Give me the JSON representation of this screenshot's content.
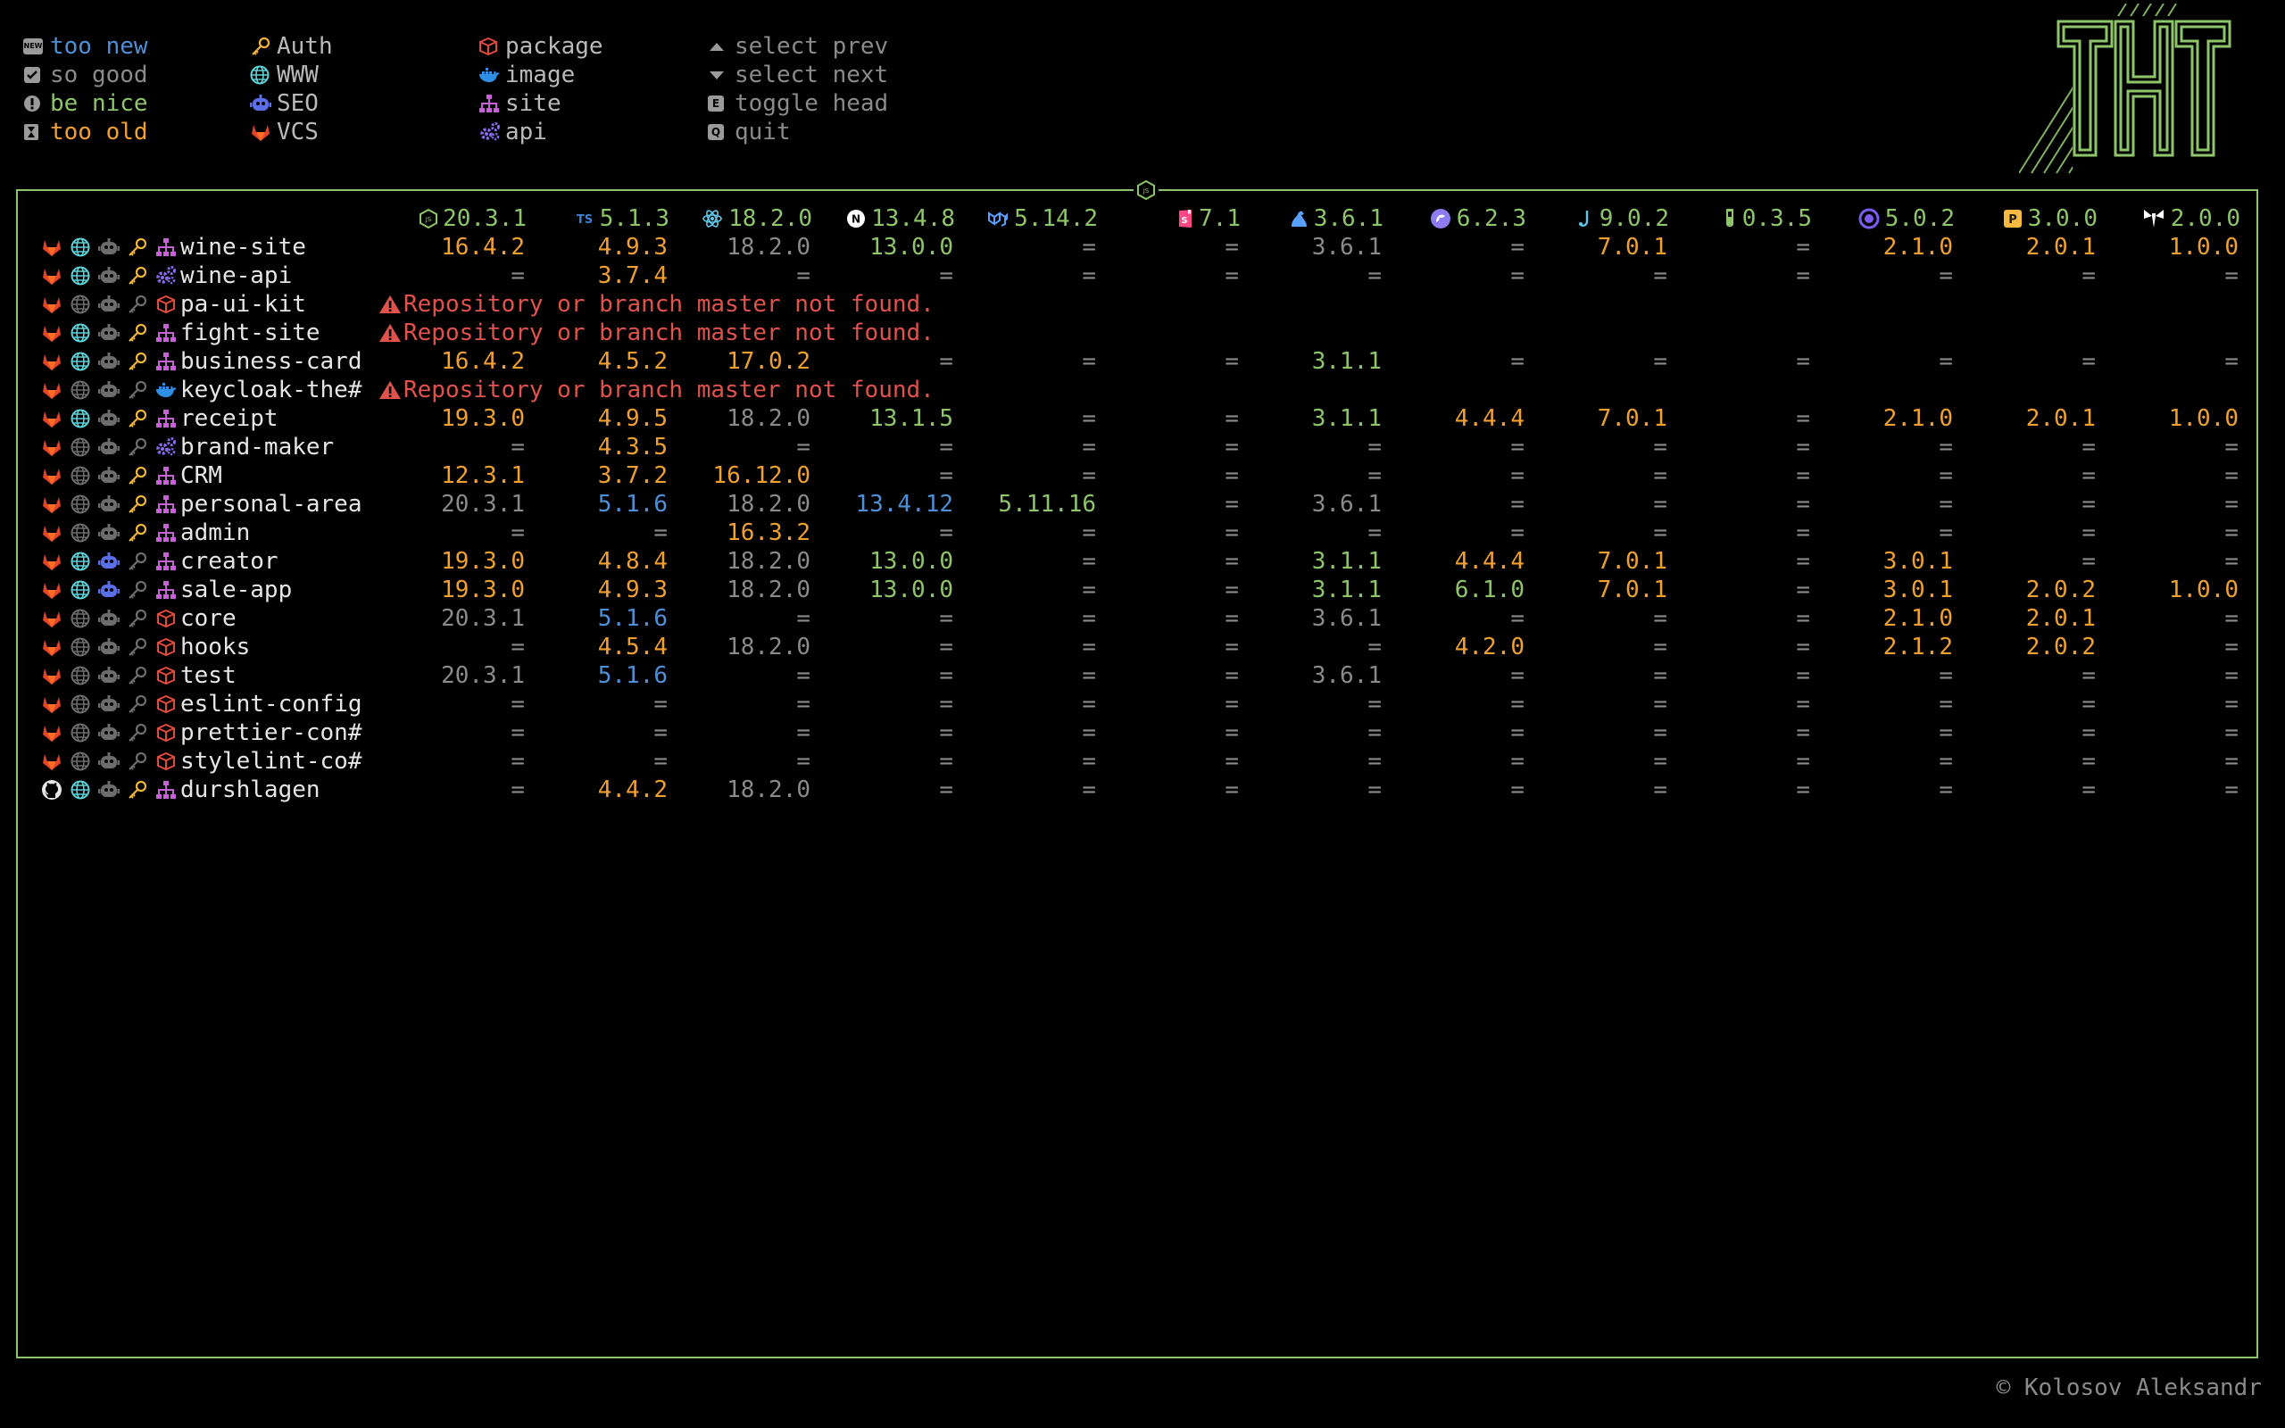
{
  "legend": {
    "status": [
      {
        "icon": "new-badge-icon",
        "label": "too new",
        "color": "#4f8fd6"
      },
      {
        "icon": "checkbox-icon",
        "label": "so good",
        "color": "#8a8a8a"
      },
      {
        "icon": "exclamation-icon",
        "label": "be nice",
        "color": "#8ec46a"
      },
      {
        "icon": "hourglass-icon",
        "label": "too old",
        "color": "#f0a030"
      }
    ],
    "tags": [
      {
        "icon": "key-icon",
        "label": "Auth"
      },
      {
        "icon": "globe-icon",
        "label": "WWW"
      },
      {
        "icon": "robot-icon",
        "label": "SEO"
      },
      {
        "icon": "gitlab-icon",
        "label": "VCS"
      }
    ],
    "types": [
      {
        "icon": "package-icon",
        "label": "package"
      },
      {
        "icon": "docker-icon",
        "label": "image"
      },
      {
        "icon": "sitemap-icon",
        "label": "site"
      },
      {
        "icon": "gears-icon",
        "label": "api"
      }
    ],
    "keys": [
      {
        "icon": "arrow-up-icon",
        "label": "select prev"
      },
      {
        "icon": "arrow-down-icon",
        "label": "select next"
      },
      {
        "icon": "key-e-icon",
        "label": "toggle head",
        "key": "E"
      },
      {
        "icon": "key-q-icon",
        "label": "quit",
        "key": "Q"
      }
    ]
  },
  "frame_badge_icon": "nodejs-icon",
  "columns": [
    {
      "icon": "nodejs-icon",
      "version": "20.3.1",
      "color": "#8ec46a"
    },
    {
      "icon": "typescript-icon",
      "version": "5.1.3",
      "color": "#3f7fd0"
    },
    {
      "icon": "react-icon",
      "version": "18.2.0",
      "color": "#5fc8e8"
    },
    {
      "icon": "nextjs-icon",
      "version": "13.4.8",
      "color": "#ffffff"
    },
    {
      "icon": "mui-icon",
      "version": "5.14.2",
      "color": "#5aa0ff"
    },
    {
      "icon": "storybook-icon",
      "version": "7.1",
      "color": "#ff4785"
    },
    {
      "icon": "redux-saga-icon",
      "version": "3.6.1",
      "color": "#5aa0ff"
    },
    {
      "icon": "styled-components-icon",
      "version": "6.2.3",
      "color": "#8c7cf0"
    },
    {
      "icon": "jest-icon",
      "version": "9.0.2",
      "color": "#5fc8e8"
    },
    {
      "icon": "vitest-icon",
      "version": "0.3.5",
      "color": "#8ec46a"
    },
    {
      "icon": "vite-icon",
      "version": "5.0.2",
      "color": "#7a5cf0"
    },
    {
      "icon": "prettier-icon",
      "version": "3.0.0",
      "color": "#f7b93e"
    },
    {
      "icon": "tuxedo-icon",
      "version": "2.0.0",
      "color": "#ffffff"
    }
  ],
  "projects": [
    {
      "name": "wine-site",
      "vcs": "gitlab",
      "www": true,
      "seo": false,
      "auth": true,
      "type": "site",
      "values": [
        [
          "16.4.2",
          "orange"
        ],
        [
          "4.9.3",
          "orange"
        ],
        [
          "18.2.0",
          "grey"
        ],
        [
          "13.0.0",
          "green"
        ],
        [
          "=",
          "dash"
        ],
        [
          "=",
          "dash"
        ],
        [
          "3.6.1",
          "grey"
        ],
        [
          "=",
          "dash"
        ],
        [
          "7.0.1",
          "orange"
        ],
        [
          "=",
          "dash"
        ],
        [
          "2.1.0",
          "orange"
        ],
        [
          "2.0.1",
          "orange"
        ],
        [
          "1.0.0",
          "orange"
        ]
      ]
    },
    {
      "name": "wine-api",
      "vcs": "gitlab",
      "www": true,
      "seo": false,
      "auth": true,
      "type": "api",
      "values": [
        [
          "=",
          "dash"
        ],
        [
          "3.7.4",
          "orange"
        ],
        [
          "=",
          "dash"
        ],
        [
          "=",
          "dash"
        ],
        [
          "=",
          "dash"
        ],
        [
          "=",
          "dash"
        ],
        [
          "=",
          "dash"
        ],
        [
          "=",
          "dash"
        ],
        [
          "=",
          "dash"
        ],
        [
          "=",
          "dash"
        ],
        [
          "=",
          "dash"
        ],
        [
          "=",
          "dash"
        ],
        [
          "=",
          "dash"
        ]
      ]
    },
    {
      "name": "pa-ui-kit",
      "vcs": "gitlab",
      "www": false,
      "seo": false,
      "auth": false,
      "type": "package",
      "error": "Repository or branch master not found."
    },
    {
      "name": "fight-site",
      "vcs": "gitlab",
      "www": true,
      "seo": false,
      "auth": true,
      "type": "site",
      "error": "Repository or branch master not found."
    },
    {
      "name": "business-card",
      "vcs": "gitlab",
      "www": true,
      "seo": false,
      "auth": true,
      "type": "site",
      "values": [
        [
          "16.4.2",
          "orange"
        ],
        [
          "4.5.2",
          "orange"
        ],
        [
          "17.0.2",
          "orange"
        ],
        [
          "=",
          "dash"
        ],
        [
          "=",
          "dash"
        ],
        [
          "=",
          "dash"
        ],
        [
          "3.1.1",
          "green"
        ],
        [
          "=",
          "dash"
        ],
        [
          "=",
          "dash"
        ],
        [
          "=",
          "dash"
        ],
        [
          "=",
          "dash"
        ],
        [
          "=",
          "dash"
        ],
        [
          "=",
          "dash"
        ]
      ]
    },
    {
      "name": "keycloak-the#",
      "vcs": "gitlab",
      "www": false,
      "seo": false,
      "auth": false,
      "type": "image",
      "error": "Repository or branch master not found."
    },
    {
      "name": "receipt",
      "vcs": "gitlab",
      "www": true,
      "seo": false,
      "auth": true,
      "type": "site",
      "values": [
        [
          "19.3.0",
          "orange"
        ],
        [
          "4.9.5",
          "orange"
        ],
        [
          "18.2.0",
          "grey"
        ],
        [
          "13.1.5",
          "green"
        ],
        [
          "=",
          "dash"
        ],
        [
          "=",
          "dash"
        ],
        [
          "3.1.1",
          "green"
        ],
        [
          "4.4.4",
          "orange"
        ],
        [
          "7.0.1",
          "orange"
        ],
        [
          "=",
          "dash"
        ],
        [
          "2.1.0",
          "orange"
        ],
        [
          "2.0.1",
          "orange"
        ],
        [
          "1.0.0",
          "orange"
        ]
      ]
    },
    {
      "name": "brand-maker",
      "vcs": "gitlab",
      "www": false,
      "seo": false,
      "auth": false,
      "type": "api",
      "values": [
        [
          "=",
          "dash"
        ],
        [
          "4.3.5",
          "orange"
        ],
        [
          "=",
          "dash"
        ],
        [
          "=",
          "dash"
        ],
        [
          "=",
          "dash"
        ],
        [
          "=",
          "dash"
        ],
        [
          "=",
          "dash"
        ],
        [
          "=",
          "dash"
        ],
        [
          "=",
          "dash"
        ],
        [
          "=",
          "dash"
        ],
        [
          "=",
          "dash"
        ],
        [
          "=",
          "dash"
        ],
        [
          "=",
          "dash"
        ]
      ]
    },
    {
      "name": "CRM",
      "vcs": "gitlab",
      "www": false,
      "seo": false,
      "auth": true,
      "type": "site",
      "values": [
        [
          "12.3.1",
          "orange"
        ],
        [
          "3.7.2",
          "orange"
        ],
        [
          "16.12.0",
          "orange"
        ],
        [
          "=",
          "dash"
        ],
        [
          "=",
          "dash"
        ],
        [
          "=",
          "dash"
        ],
        [
          "=",
          "dash"
        ],
        [
          "=",
          "dash"
        ],
        [
          "=",
          "dash"
        ],
        [
          "=",
          "dash"
        ],
        [
          "=",
          "dash"
        ],
        [
          "=",
          "dash"
        ],
        [
          "=",
          "dash"
        ]
      ]
    },
    {
      "name": "personal-area",
      "vcs": "gitlab",
      "www": false,
      "seo": false,
      "auth": true,
      "type": "site",
      "values": [
        [
          "20.3.1",
          "grey"
        ],
        [
          "5.1.6",
          "blue"
        ],
        [
          "18.2.0",
          "grey"
        ],
        [
          "13.4.12",
          "blue"
        ],
        [
          "5.11.16",
          "green"
        ],
        [
          "=",
          "dash"
        ],
        [
          "3.6.1",
          "grey"
        ],
        [
          "=",
          "dash"
        ],
        [
          "=",
          "dash"
        ],
        [
          "=",
          "dash"
        ],
        [
          "=",
          "dash"
        ],
        [
          "=",
          "dash"
        ],
        [
          "=",
          "dash"
        ]
      ]
    },
    {
      "name": "admin",
      "vcs": "gitlab",
      "www": false,
      "seo": false,
      "auth": true,
      "type": "site",
      "values": [
        [
          "=",
          "dash"
        ],
        [
          "=",
          "dash"
        ],
        [
          "16.3.2",
          "orange"
        ],
        [
          "=",
          "dash"
        ],
        [
          "=",
          "dash"
        ],
        [
          "=",
          "dash"
        ],
        [
          "=",
          "dash"
        ],
        [
          "=",
          "dash"
        ],
        [
          "=",
          "dash"
        ],
        [
          "=",
          "dash"
        ],
        [
          "=",
          "dash"
        ],
        [
          "=",
          "dash"
        ],
        [
          "=",
          "dash"
        ]
      ]
    },
    {
      "name": "creator",
      "vcs": "gitlab",
      "www": true,
      "seo": true,
      "auth": false,
      "type": "site",
      "values": [
        [
          "19.3.0",
          "orange"
        ],
        [
          "4.8.4",
          "orange"
        ],
        [
          "18.2.0",
          "grey"
        ],
        [
          "13.0.0",
          "green"
        ],
        [
          "=",
          "dash"
        ],
        [
          "=",
          "dash"
        ],
        [
          "3.1.1",
          "green"
        ],
        [
          "4.4.4",
          "orange"
        ],
        [
          "7.0.1",
          "orange"
        ],
        [
          "=",
          "dash"
        ],
        [
          "3.0.1",
          "orange"
        ],
        [
          "=",
          "dash"
        ],
        [
          "=",
          "dash"
        ]
      ]
    },
    {
      "name": "sale-app",
      "vcs": "gitlab",
      "www": true,
      "seo": true,
      "auth": false,
      "type": "site",
      "values": [
        [
          "19.3.0",
          "orange"
        ],
        [
          "4.9.3",
          "orange"
        ],
        [
          "18.2.0",
          "grey"
        ],
        [
          "13.0.0",
          "green"
        ],
        [
          "=",
          "dash"
        ],
        [
          "=",
          "dash"
        ],
        [
          "3.1.1",
          "green"
        ],
        [
          "6.1.0",
          "green"
        ],
        [
          "7.0.1",
          "orange"
        ],
        [
          "=",
          "dash"
        ],
        [
          "3.0.1",
          "orange"
        ],
        [
          "2.0.2",
          "orange"
        ],
        [
          "1.0.0",
          "orange"
        ]
      ]
    },
    {
      "name": "core",
      "vcs": "gitlab",
      "www": false,
      "seo": false,
      "auth": false,
      "type": "package",
      "values": [
        [
          "20.3.1",
          "grey"
        ],
        [
          "5.1.6",
          "blue"
        ],
        [
          "=",
          "dash"
        ],
        [
          "=",
          "dash"
        ],
        [
          "=",
          "dash"
        ],
        [
          "=",
          "dash"
        ],
        [
          "3.6.1",
          "grey"
        ],
        [
          "=",
          "dash"
        ],
        [
          "=",
          "dash"
        ],
        [
          "=",
          "dash"
        ],
        [
          "2.1.0",
          "orange"
        ],
        [
          "2.0.1",
          "orange"
        ],
        [
          "=",
          "dash"
        ]
      ]
    },
    {
      "name": "hooks",
      "vcs": "gitlab",
      "www": false,
      "seo": false,
      "auth": false,
      "type": "package",
      "values": [
        [
          "=",
          "dash"
        ],
        [
          "4.5.4",
          "orange"
        ],
        [
          "18.2.0",
          "grey"
        ],
        [
          "=",
          "dash"
        ],
        [
          "=",
          "dash"
        ],
        [
          "=",
          "dash"
        ],
        [
          "=",
          "dash"
        ],
        [
          "4.2.0",
          "orange"
        ],
        [
          "=",
          "dash"
        ],
        [
          "=",
          "dash"
        ],
        [
          "2.1.2",
          "orange"
        ],
        [
          "2.0.2",
          "orange"
        ],
        [
          "=",
          "dash"
        ]
      ]
    },
    {
      "name": "test",
      "vcs": "gitlab",
      "www": false,
      "seo": false,
      "auth": false,
      "type": "package",
      "values": [
        [
          "20.3.1",
          "grey"
        ],
        [
          "5.1.6",
          "blue"
        ],
        [
          "=",
          "dash"
        ],
        [
          "=",
          "dash"
        ],
        [
          "=",
          "dash"
        ],
        [
          "=",
          "dash"
        ],
        [
          "3.6.1",
          "grey"
        ],
        [
          "=",
          "dash"
        ],
        [
          "=",
          "dash"
        ],
        [
          "=",
          "dash"
        ],
        [
          "=",
          "dash"
        ],
        [
          "=",
          "dash"
        ],
        [
          "=",
          "dash"
        ]
      ]
    },
    {
      "name": "eslint-config",
      "vcs": "gitlab",
      "www": false,
      "seo": false,
      "auth": false,
      "type": "package",
      "values": [
        [
          "=",
          "dash"
        ],
        [
          "=",
          "dash"
        ],
        [
          "=",
          "dash"
        ],
        [
          "=",
          "dash"
        ],
        [
          "=",
          "dash"
        ],
        [
          "=",
          "dash"
        ],
        [
          "=",
          "dash"
        ],
        [
          "=",
          "dash"
        ],
        [
          "=",
          "dash"
        ],
        [
          "=",
          "dash"
        ],
        [
          "=",
          "dash"
        ],
        [
          "=",
          "dash"
        ],
        [
          "=",
          "dash"
        ]
      ]
    },
    {
      "name": "prettier-con#",
      "vcs": "gitlab",
      "www": false,
      "seo": false,
      "auth": false,
      "type": "package",
      "values": [
        [
          "=",
          "dash"
        ],
        [
          "=",
          "dash"
        ],
        [
          "=",
          "dash"
        ],
        [
          "=",
          "dash"
        ],
        [
          "=",
          "dash"
        ],
        [
          "=",
          "dash"
        ],
        [
          "=",
          "dash"
        ],
        [
          "=",
          "dash"
        ],
        [
          "=",
          "dash"
        ],
        [
          "=",
          "dash"
        ],
        [
          "=",
          "dash"
        ],
        [
          "=",
          "dash"
        ],
        [
          "=",
          "dash"
        ]
      ]
    },
    {
      "name": "stylelint-co#",
      "vcs": "gitlab",
      "www": false,
      "seo": false,
      "auth": false,
      "type": "package",
      "values": [
        [
          "=",
          "dash"
        ],
        [
          "=",
          "dash"
        ],
        [
          "=",
          "dash"
        ],
        [
          "=",
          "dash"
        ],
        [
          "=",
          "dash"
        ],
        [
          "=",
          "dash"
        ],
        [
          "=",
          "dash"
        ],
        [
          "=",
          "dash"
        ],
        [
          "=",
          "dash"
        ],
        [
          "=",
          "dash"
        ],
        [
          "=",
          "dash"
        ],
        [
          "=",
          "dash"
        ],
        [
          "=",
          "dash"
        ]
      ]
    },
    {
      "name": "durshlagen",
      "vcs": "github",
      "www": true,
      "seo": false,
      "auth": true,
      "type": "site",
      "values": [
        [
          "=",
          "dash"
        ],
        [
          "4.4.2",
          "orange"
        ],
        [
          "18.2.0",
          "grey"
        ],
        [
          "=",
          "dash"
        ],
        [
          "=",
          "dash"
        ],
        [
          "=",
          "dash"
        ],
        [
          "=",
          "dash"
        ],
        [
          "=",
          "dash"
        ],
        [
          "=",
          "dash"
        ],
        [
          "=",
          "dash"
        ],
        [
          "=",
          "dash"
        ],
        [
          "=",
          "dash"
        ],
        [
          "=",
          "dash"
        ]
      ]
    }
  ],
  "colors": {
    "frame": "#8ec46a",
    "orange": "#f0a030",
    "green": "#8ec46a",
    "grey": "#8a8a8a",
    "blue": "#4f8fd6",
    "error": "#e0524b",
    "gitlab": "#e2432a",
    "www": "#5fd1d8",
    "seo": "#5a6ee8",
    "auth": "#f0b43a",
    "site": "#c860d8",
    "api": "#8a6cf0",
    "package": "#e24a3a",
    "image": "#2f8fe6"
  },
  "copyright": "© Kolosov Aleksandr"
}
